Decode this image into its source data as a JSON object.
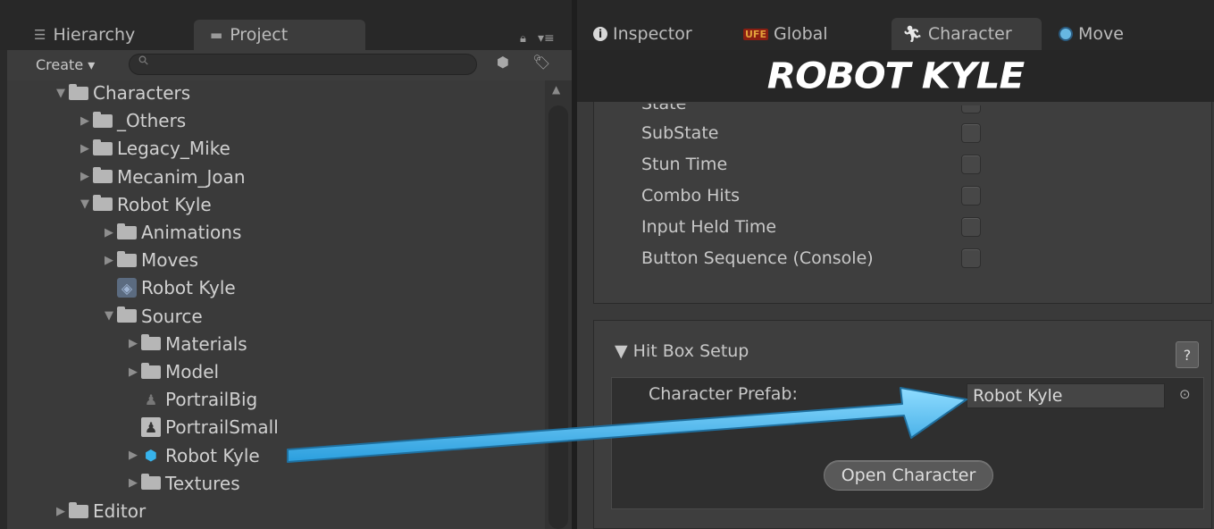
{
  "left_panel": {
    "tabs": {
      "hierarchy": "Hierarchy",
      "project": "Project"
    },
    "toolbar": {
      "create": "Create ▾",
      "search_placeholder": ""
    },
    "tree": [
      {
        "label": "Characters",
        "depth": 0,
        "expanded": true,
        "icon": "folder"
      },
      {
        "label": "_Others",
        "depth": 1,
        "expanded": false,
        "icon": "folder"
      },
      {
        "label": "Legacy_Mike",
        "depth": 1,
        "expanded": false,
        "icon": "folder"
      },
      {
        "label": "Mecanim_Joan",
        "depth": 1,
        "expanded": false,
        "icon": "folder"
      },
      {
        "label": "Robot Kyle",
        "depth": 1,
        "expanded": true,
        "icon": "folder"
      },
      {
        "label": "Animations",
        "depth": 2,
        "expanded": false,
        "icon": "folder"
      },
      {
        "label": "Moves",
        "depth": 2,
        "expanded": false,
        "icon": "folder"
      },
      {
        "label": "Robot Kyle",
        "depth": 2,
        "expanded": null,
        "icon": "unity-asset"
      },
      {
        "label": "Source",
        "depth": 2,
        "expanded": true,
        "icon": "folder"
      },
      {
        "label": "Materials",
        "depth": 3,
        "expanded": false,
        "icon": "folder"
      },
      {
        "label": "Model",
        "depth": 3,
        "expanded": false,
        "icon": "folder"
      },
      {
        "label": "PortrailBig",
        "depth": 3,
        "expanded": null,
        "icon": "image-dark"
      },
      {
        "label": "PortrailSmall",
        "depth": 3,
        "expanded": null,
        "icon": "image"
      },
      {
        "label": "Robot Kyle",
        "depth": 3,
        "expanded": false,
        "icon": "prefab-cube"
      },
      {
        "label": "Textures",
        "depth": 3,
        "expanded": false,
        "icon": "folder"
      },
      {
        "label": "Editor",
        "depth": 0,
        "expanded": false,
        "icon": "folder"
      }
    ]
  },
  "right_panel": {
    "tabs": {
      "inspector": "Inspector",
      "global": "Global",
      "character": "Character",
      "move": "Move",
      "global_badge": "UFE"
    },
    "character_title": "ROBOT KYLE",
    "state_fields": [
      {
        "label": "State",
        "checked": false
      },
      {
        "label": "SubState",
        "checked": false
      },
      {
        "label": "Stun Time",
        "checked": false
      },
      {
        "label": "Combo Hits",
        "checked": false
      },
      {
        "label": "Input Held Time",
        "checked": false
      },
      {
        "label": "Button Sequence (Console)",
        "checked": false
      }
    ],
    "hitbox": {
      "header": "▼ Hit Box Setup",
      "help": "?",
      "prefab_label": "Character Prefab:",
      "prefab_value": "Robot Kyle",
      "open_button": "Open Character"
    }
  },
  "colors": {
    "panel_bg": "#3a3a3a",
    "tab_bar": "#282828",
    "arrow": "#4fb8f0",
    "text": "#c8c8c8"
  }
}
